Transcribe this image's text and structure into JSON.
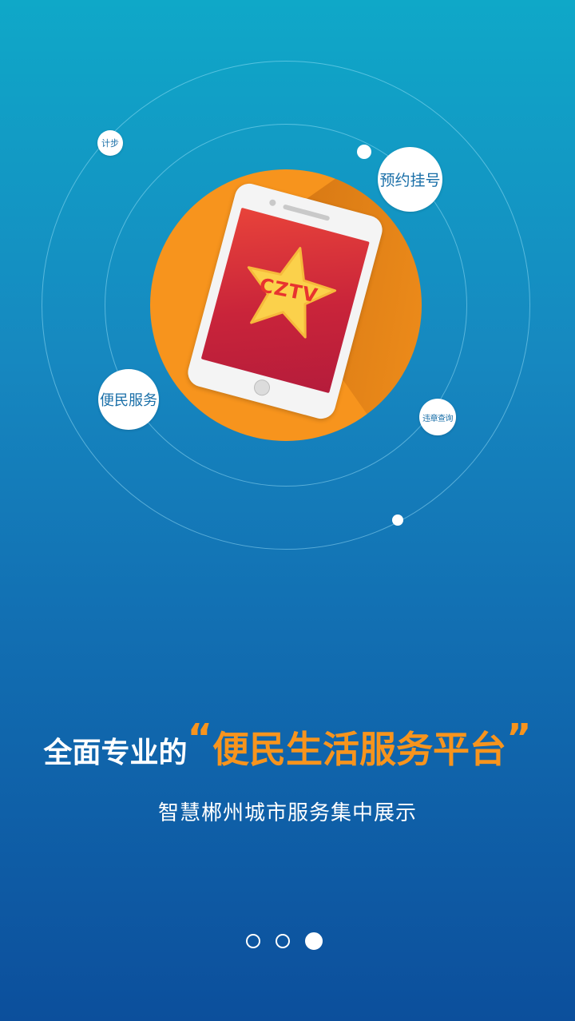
{
  "hero": {
    "logo_text": "CZTV",
    "bubbles": {
      "steps": "计步",
      "appointment": "预约挂号",
      "convenience": "便民服务",
      "violation_query": "违章查询"
    }
  },
  "headline": {
    "prefix": "全面专业的",
    "open_quote": "“",
    "highlight": "便民生活服务平台",
    "close_quote": "”"
  },
  "subtitle": "智慧郴州城市服务集中展示",
  "pager": {
    "total": 3,
    "active_index": 2
  },
  "colors": {
    "background_top": "#0fa8c8",
    "background_bottom": "#0c4f9c",
    "accent_orange": "#f7941d",
    "screen_red": "#c9243a"
  }
}
